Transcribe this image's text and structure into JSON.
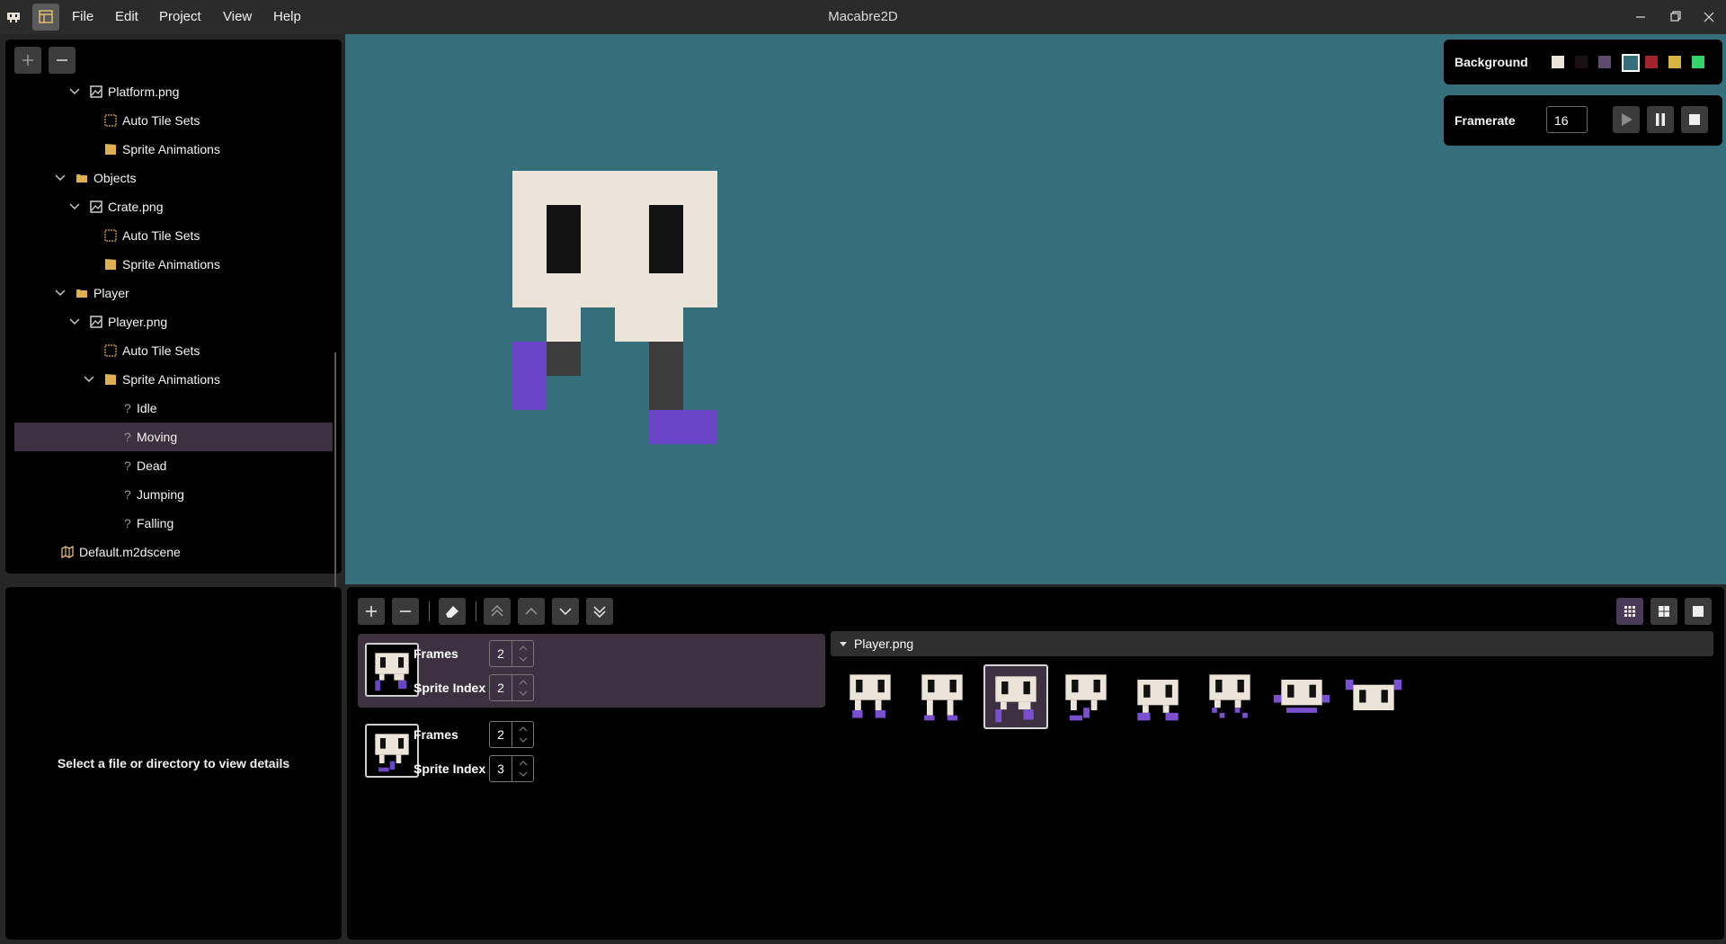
{
  "app": {
    "title": "Macabre2D"
  },
  "menu": {
    "file": "File",
    "edit": "Edit",
    "project": "Project",
    "view": "View",
    "help": "Help"
  },
  "tree": {
    "items": [
      {
        "label": "Platform.png",
        "icon": "image-icon"
      },
      {
        "label": "Auto Tile Sets",
        "icon": "tileset-icon"
      },
      {
        "label": "Sprite Animations",
        "icon": "animation-icon"
      },
      {
        "label": "Objects",
        "icon": "folder-icon"
      },
      {
        "label": "Crate.png",
        "icon": "image-icon"
      },
      {
        "label": "Auto Tile Sets",
        "icon": "tileset-icon"
      },
      {
        "label": "Sprite Animations",
        "icon": "animation-icon"
      },
      {
        "label": "Player",
        "icon": "folder-icon"
      },
      {
        "label": "Player.png",
        "icon": "image-icon"
      },
      {
        "label": "Auto Tile Sets",
        "icon": "tileset-icon"
      },
      {
        "label": "Sprite Animations",
        "icon": "animation-icon"
      },
      {
        "label": "Idle",
        "icon": "question-icon"
      },
      {
        "label": "Moving",
        "icon": "question-icon"
      },
      {
        "label": "Dead",
        "icon": "question-icon"
      },
      {
        "label": "Jumping",
        "icon": "question-icon"
      },
      {
        "label": "Falling",
        "icon": "question-icon"
      },
      {
        "label": "Default.m2dscene",
        "icon": "scene-icon"
      }
    ],
    "selected": "Moving"
  },
  "details": {
    "message": "Select a file or directory to view details"
  },
  "viewport": {
    "background_label": "Background",
    "swatches": [
      "#ece4d8",
      "#1b1013",
      "#5f4a6e",
      "#366f7c",
      "#a3232c",
      "#d6b442",
      "#36d36b"
    ],
    "selected_swatch": "#366f7c",
    "framerate_label": "Framerate",
    "framerate_value": "16"
  },
  "animation": {
    "steps": [
      {
        "frames_label": "Frames",
        "frames": "2",
        "index_label": "Sprite Index",
        "index": "2"
      },
      {
        "frames_label": "Frames",
        "frames": "2",
        "index_label": "Sprite Index",
        "index": "3"
      }
    ]
  },
  "sheet": {
    "title": "Player.png",
    "sprite_count": 8,
    "selected_index": 2
  },
  "colors": {
    "accent": "#3d3040",
    "viewport": "#366f7c",
    "bone": "#ece4d8",
    "purple": "#7a4fd0"
  }
}
